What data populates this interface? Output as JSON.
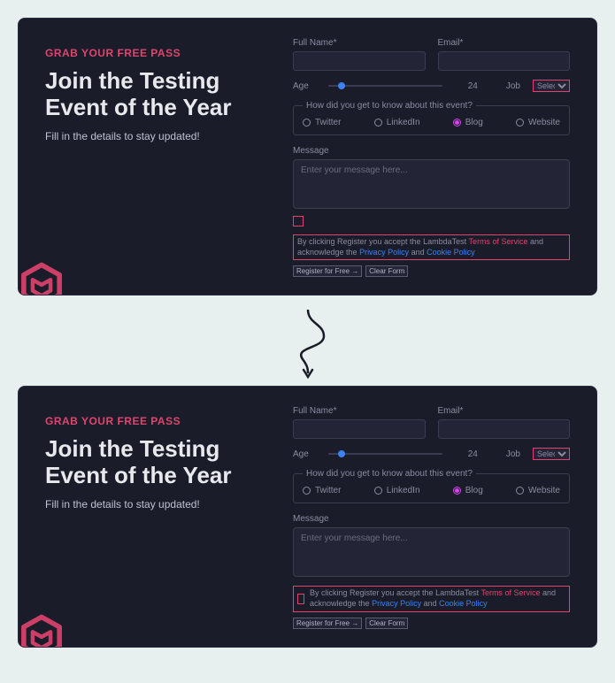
{
  "eyebrow": "GRAB YOUR FREE PASS",
  "headline": "Join the Testing Event of the Year",
  "subline": "Fill in the details to stay updated!",
  "form": {
    "full_name_label": "Full Name*",
    "email_label": "Email*",
    "age_label": "Age",
    "age_value": "24",
    "job_label": "Job",
    "job_selected": "Select",
    "radios_legend": "How did you get to know about this event?",
    "radio_twitter": "Twitter",
    "radio_linkedin": "LinkedIn",
    "radio_blog": "Blog",
    "radio_website": "Website",
    "message_label": "Message",
    "message_placeholder": "Enter your message here...",
    "terms_prefix": "By clicking Register you accept the LambdaTest ",
    "terms_tos": "Terms of Service",
    "terms_mid": " and acknowledge the ",
    "terms_privacy": "Privacy Policy",
    "terms_and": " and ",
    "terms_cookie": "Cookie Policy",
    "register_btn": "Register for Free →",
    "clear_btn": "Clear Form"
  }
}
